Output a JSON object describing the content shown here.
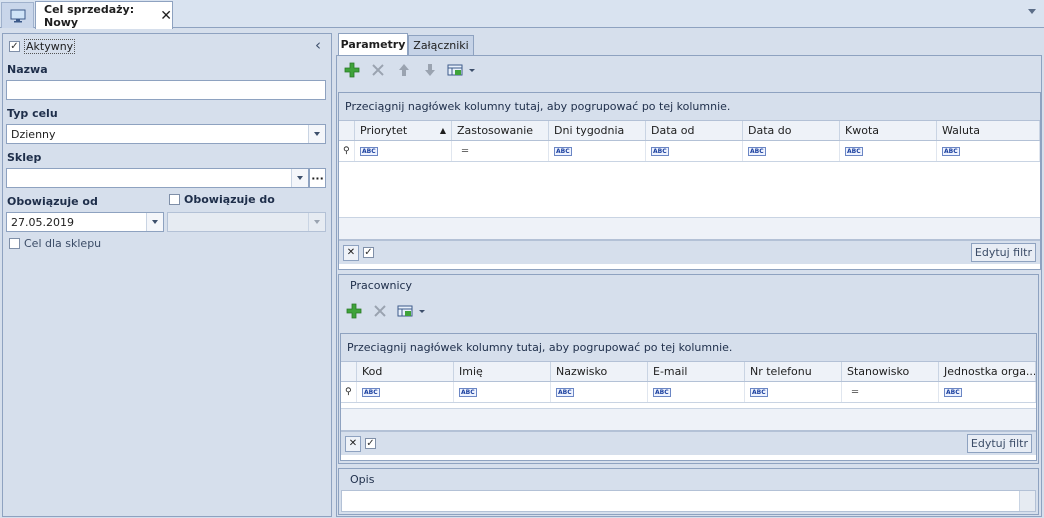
{
  "window_tab": {
    "title": "Cel sprzedaży: Nowy",
    "close": "✕"
  },
  "left": {
    "aktywny_label": "Aktywny",
    "nazwa_label": "Nazwa",
    "nazwa_value": "",
    "typ_celu_label": "Typ celu",
    "typ_celu_value": "Dzienny",
    "sklep_label": "Sklep",
    "sklep_value": "",
    "sklep_more": "···",
    "obowiazuje_od_label": "Obowiązuje od",
    "obowiazuje_od_value": "27.05.2019",
    "obowiazuje_do_label": "Obowiązuje do",
    "cel_dla_sklepu_label": "Cel dla sklepu",
    "collapse": "‹"
  },
  "tabs": [
    {
      "label": "Parametry"
    },
    {
      "label": "Załączniki"
    }
  ],
  "parametry": {
    "group_hint": "Przeciągnij nagłówek kolumny tutaj, aby pogrupować po tej kolumnie.",
    "columns": [
      "Priorytet",
      "Zastosowanie",
      "Dni tygodnia",
      "Data od",
      "Data do",
      "Kwota",
      "Waluta"
    ],
    "filter_types": [
      "abc",
      "eq",
      "abc",
      "abc",
      "abc",
      "abc",
      "abc"
    ],
    "edit_filter": "Edytuj filtr"
  },
  "pracownicy": {
    "title": "Pracownicy",
    "group_hint": "Przeciągnij nagłówek kolumny tutaj, aby pogrupować po tej kolumnie.",
    "columns": [
      "Kod",
      "Imię",
      "Nazwisko",
      "E-mail",
      "Nr telefonu",
      "Stanowisko",
      "Jednostka orga..."
    ],
    "filter_types": [
      "abc",
      "abc",
      "abc",
      "abc",
      "abc",
      "eq",
      "abc"
    ],
    "edit_filter": "Edytuj filtr"
  },
  "opis": {
    "title": "Opis"
  },
  "glyphs": {
    "abc": "ABC",
    "eq": "═"
  },
  "colors": {
    "add": "#3fa33a",
    "disabled": "#9aa3b0",
    "frame": "#8ea2c0",
    "background": "#d6dfec"
  }
}
